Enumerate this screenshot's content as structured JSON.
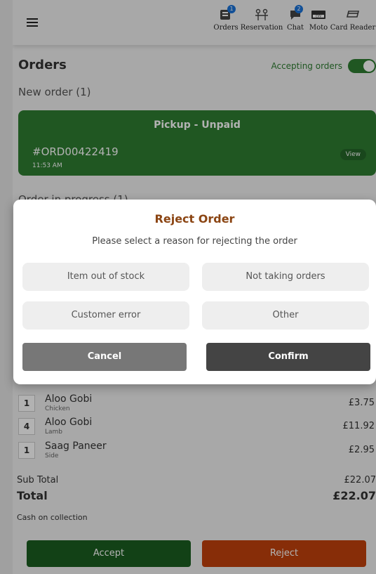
{
  "topbar": {
    "icons": [
      {
        "label": "Orders",
        "badge": "1",
        "icon": "orders-icon"
      },
      {
        "label": "Reservation",
        "badge": "",
        "icon": "reservation-icon"
      },
      {
        "label": "Chat",
        "badge": "2",
        "icon": "chat-icon"
      },
      {
        "label": "Moto",
        "badge": "",
        "icon": "moto-icon"
      },
      {
        "label": "Card Reader",
        "badge": "",
        "icon": "card-reader-icon"
      }
    ]
  },
  "page": {
    "title": "Orders",
    "accepting_label": "Accepting orders",
    "accepting_on": true,
    "new_order_heading": "New order (1)",
    "in_progress_heading": "Order in progress (1)"
  },
  "new_order": {
    "type": "Pickup - Unpaid",
    "number": "#ORD00422419",
    "time": "11:53 AM",
    "view_label": "View"
  },
  "items": [
    {
      "qty": "1",
      "name": "Aloo Gobi",
      "sub": "Chicken",
      "price": "£3.75"
    },
    {
      "qty": "4",
      "name": "Aloo Gobi",
      "sub": "Lamb",
      "price": "£11.92"
    },
    {
      "qty": "1",
      "name": "Saag Paneer",
      "sub": "Side",
      "price": "£2.95"
    }
  ],
  "totals": {
    "subtotal_label": "Sub Total",
    "subtotal_value": "£22.07",
    "total_label": "Total",
    "total_value": "£22.07",
    "payment": "Cash on collection"
  },
  "actions": {
    "accept": "Accept",
    "reject": "Reject"
  },
  "dialog": {
    "title": "Reject Order",
    "prompt": "Please select a reason for rejecting the order",
    "reasons": [
      "Item out of stock",
      "Not taking orders",
      "Customer error",
      "Other"
    ],
    "cancel": "Cancel",
    "confirm": "Confirm"
  },
  "colors": {
    "accent_green": "#2e7d32",
    "dark_green": "#1b5e20",
    "reject_orange": "#c2410c",
    "dialog_title": "#8b4513",
    "badge_blue": "#1a73d8"
  }
}
